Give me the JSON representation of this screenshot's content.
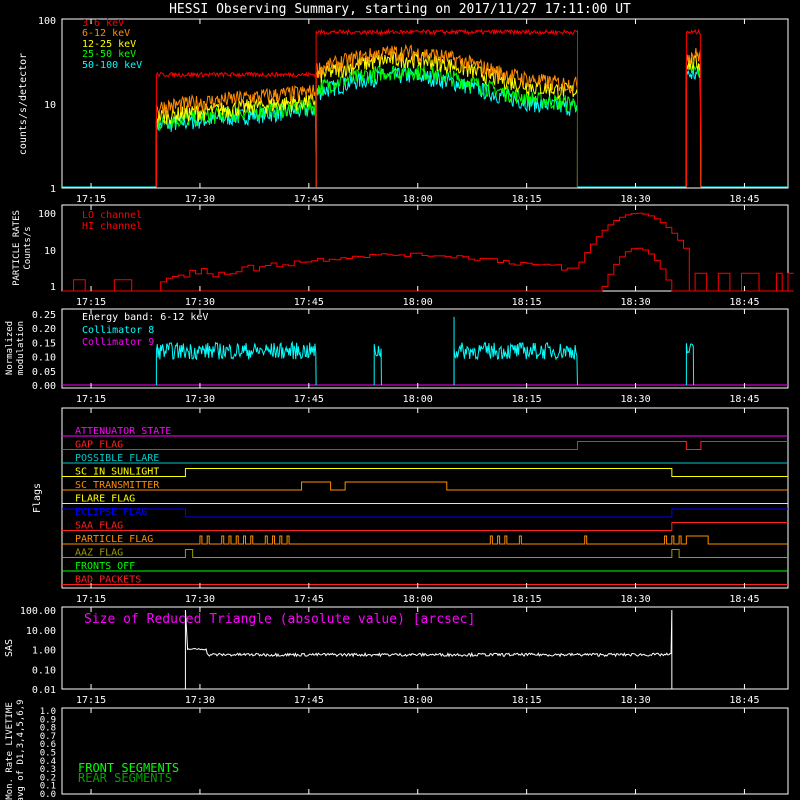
{
  "page_title": "HESSI Observing Summary, starting on 2017/11/27 17:11:00 UT",
  "time_ticks": [
    "17:15",
    "17:30",
    "17:45",
    "18:00",
    "18:15",
    "18:30",
    "18:45"
  ],
  "colors": {
    "background": "#000000",
    "axes": "#ffffff",
    "red": "#ff0000",
    "orange": "#ff8c00",
    "yellow": "#ffff00",
    "green": "#00ff00",
    "cyan": "#00ffff",
    "magenta": "#ff00ff",
    "blue": "#0000ff",
    "olive": "#9c9c00",
    "dkgreen": "#00a000"
  },
  "chart_data": [
    {
      "type": "line",
      "panel": "count-rates",
      "ylabel": "counts/s/detector",
      "yscale": "log",
      "ylim": [
        1,
        100
      ],
      "y_ticks": [
        "1",
        "10",
        "100"
      ],
      "xlim_minutes_after_start": [
        0,
        100
      ],
      "series": [
        {
          "name": "3-6 keV",
          "color": "#ff0000"
        },
        {
          "name": "6-12 keV",
          "color": "#ff8c00"
        },
        {
          "name": "12-25 keV",
          "color": "#ffff00"
        },
        {
          "name": "25-50 keV",
          "color": "#00ff00"
        },
        {
          "name": "50-100 keV",
          "color": "#00ffff"
        }
      ],
      "segments": [
        {
          "start": "17:24",
          "end": "17:46",
          "levels": [
            22,
            9,
            7,
            6,
            5.5
          ]
        },
        {
          "start": "17:46",
          "end": "18:22",
          "levels": [
            70,
            30,
            25,
            18,
            16
          ]
        },
        {
          "start": "18:37",
          "end": "18:39",
          "levels": [
            70,
            38,
            30,
            25,
            22
          ]
        }
      ]
    },
    {
      "type": "line",
      "panel": "particle-rates",
      "ylabel": "PARTICLE RATES Counts/s",
      "yscale": "log",
      "ylim": [
        0.5,
        100
      ],
      "y_ticks": [
        "1",
        "10",
        "100"
      ],
      "series": [
        {
          "name": "LO channel",
          "color": "#ff0000"
        },
        {
          "name": "HI channel",
          "color": "#ff0000"
        }
      ],
      "peak": {
        "time": "18:30",
        "lo": 60,
        "hi": 7
      }
    },
    {
      "type": "line",
      "panel": "modulation",
      "ylabel": "Normalized modulation",
      "ylim": [
        0.0,
        0.25
      ],
      "y_ticks": [
        "0.00",
        "0.05",
        "0.10",
        "0.15",
        "0.20",
        "0.25"
      ],
      "annotation": "Energy band: 6-12 keV",
      "series": [
        {
          "name": "Collimator 8",
          "color": "#00ffff",
          "typical": 0.12
        },
        {
          "name": "Collimator 9",
          "color": "#ff00ff",
          "typical": 0.0
        }
      ]
    },
    {
      "type": "line",
      "panel": "flags",
      "ylabel": "Flags",
      "flags": [
        {
          "name": "ATTENUATOR STATE",
          "color": "#ff00ff"
        },
        {
          "name": "GAP FLAG",
          "color": "#ff2020"
        },
        {
          "name": "POSSIBLE FLARE",
          "color": "#00c8c8"
        },
        {
          "name": "SC IN SUNLIGHT",
          "color": "#ffff00"
        },
        {
          "name": "SC TRANSMITTER",
          "color": "#ff8c00"
        },
        {
          "name": "FLARE FLAG",
          "color": "#ffff00"
        },
        {
          "name": "ECLIPSE FLAG",
          "color": "#0000ff"
        },
        {
          "name": "SAA FLAG",
          "color": "#ff2020"
        },
        {
          "name": "PARTICLE FLAG",
          "color": "#ff8c00"
        },
        {
          "name": "AAZ FLAG",
          "color": "#9c9c00"
        },
        {
          "name": "FRONTS OFF",
          "color": "#00ff00"
        },
        {
          "name": "BAD PACKETS",
          "color": "#ff2020"
        }
      ]
    },
    {
      "type": "line",
      "panel": "sas",
      "ylabel": "SAS",
      "yscale": "log",
      "ylim": [
        0.01,
        100
      ],
      "y_ticks": [
        "100.00",
        "10.00",
        "1.00",
        "0.10",
        "0.01"
      ],
      "annotation": "Size of Reduced Triangle (absolute value) [arcsec]",
      "series": [
        {
          "name": "Reduced Triangle",
          "color": "#ffffff",
          "typical": 0.55
        }
      ],
      "range": {
        "start": "17:28",
        "end": "18:35"
      }
    },
    {
      "type": "line",
      "panel": "livetime",
      "ylabel": "Mon. Rate LIVETIME avg of D1,3,4,5,6,9",
      "ylim": [
        0.0,
        1.0
      ],
      "y_ticks": [
        "0.0",
        "0.1",
        "0.2",
        "0.3",
        "0.4",
        "0.5",
        "0.6",
        "0.7",
        "0.8",
        "0.9",
        "1.0"
      ],
      "series": [
        {
          "name": "FRONT SEGMENTS",
          "color": "#00ff00"
        },
        {
          "name": "REAR SEGMENTS",
          "color": "#00a000"
        }
      ]
    }
  ]
}
